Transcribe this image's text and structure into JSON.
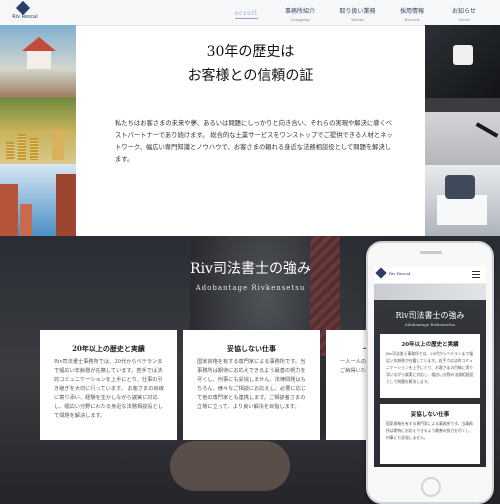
{
  "header": {
    "logo_text": "Riv Rescal",
    "nav": [
      {
        "label": "事務所紹介",
        "sub": "Company"
      },
      {
        "label": "取り扱い業務",
        "sub": "Works"
      },
      {
        "label": "採用情報",
        "sub": "Recruit"
      },
      {
        "label": "お知らせ",
        "sub": "News"
      }
    ],
    "active_nav": "scroll"
  },
  "hero": {
    "title_line1": "30年の歴史は",
    "title_line2": "お客様との信頼の証",
    "body": "私たちはお客さまの未来や夢、あるいは問題にしっかりと向き合い、それらの実現や解決に導くベストパートナーであり続けます。 総合的な土業サービスをワンストップでご提供できる人材とネットワーク、幅広い専門知識とノウハウで、お客さまの頼れる身近な法務相談役として問題を解決します。"
  },
  "strengths": {
    "title": "Riv司法書士の強み",
    "subtitle": "Adobantage Rivkensetsu",
    "cards": [
      {
        "title": "20年以上の歴史と実績",
        "text": "Riv司法書士事務所では、20代からベテランまで幅広い年齢層が在籍しています。若手では法的コミュニケーションを上手にとり、仕事の引き継ぎを大切に行っています。 お客さまの目線に寄り添い、経験を生かしながら誠実に対応し、幅広い分野にわたる身近な法務相談役として問題を解決します。"
      },
      {
        "title": "妥協しない仕事",
        "text": "国家資格を有する専門家による事務所です。当事務所は期待にお応えできるよう最善の努力を尽くし、何事にも妥協しません。法律問題はもちろん、様々なご相談にお応えし、必要に応じて他の専門家とも連携します。ご相談者さまの立場に立って、より良い解決を目指します。"
      },
      {
        "title": "一人一人のお客様へ",
        "text": "一人一人のお客様のご要望を丁寧にお聞きし、ご納得いただける内容をご提案します。"
      }
    ]
  },
  "phone": {
    "logo_text": "Riv Rescal",
    "title": "Riv司法書士の強み",
    "subtitle": "Adobantage Rivkensetsu",
    "cards": [
      {
        "title": "20年以上の歴史と実績",
        "text": "Riv司法書士事務所では、20代からベテランまで幅広い年齢層が在籍しています。若手では法的コミュニケーションを上手にとり、お客さまの目線に寄り添いながら誠実に対応し、幅広い分野の法務相談役として問題を解決します。"
      },
      {
        "title": "妥協しない仕事",
        "text": "国家資格を有する専門家による事務所です。当事務所は期待にお応えできるよう最善の努力を尽くし、何事にも妥協しません。"
      }
    ]
  }
}
